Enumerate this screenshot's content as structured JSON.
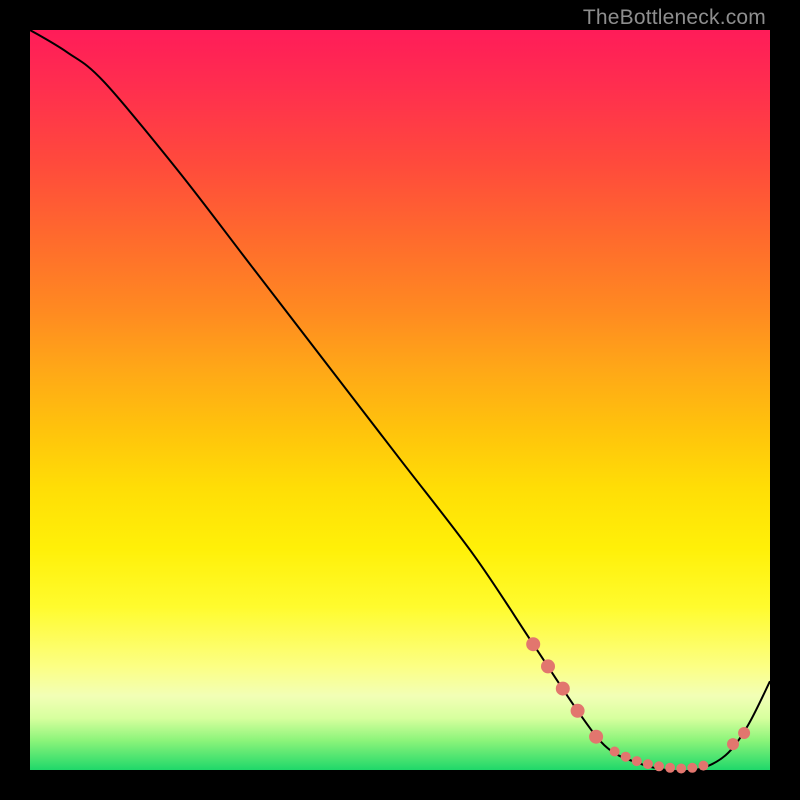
{
  "watermark": "TheBottleneck.com",
  "chart_data": {
    "type": "line",
    "title": "",
    "xlabel": "",
    "ylabel": "",
    "xlim": [
      0,
      100
    ],
    "ylim": [
      0,
      100
    ],
    "series": [
      {
        "name": "curve",
        "x": [
          0,
          5,
          10,
          20,
          30,
          40,
          50,
          60,
          68,
          74,
          78,
          82,
          86,
          90,
          94,
          97,
          100
        ],
        "y": [
          100,
          97,
          93,
          81,
          68,
          55,
          42,
          29,
          17,
          8,
          3,
          1,
          0,
          0,
          2,
          6,
          12
        ],
        "stroke": "#000000",
        "stroke_width": 2
      }
    ],
    "markers": [
      {
        "x": 68.0,
        "y": 17.0,
        "color": "#e2766e",
        "r": 7
      },
      {
        "x": 70.0,
        "y": 14.0,
        "color": "#e2766e",
        "r": 7
      },
      {
        "x": 72.0,
        "y": 11.0,
        "color": "#e2766e",
        "r": 7
      },
      {
        "x": 74.0,
        "y": 8.0,
        "color": "#e2766e",
        "r": 7
      },
      {
        "x": 76.5,
        "y": 4.5,
        "color": "#e2766e",
        "r": 7
      },
      {
        "x": 79.0,
        "y": 2.5,
        "color": "#e2766e",
        "r": 5
      },
      {
        "x": 80.5,
        "y": 1.8,
        "color": "#e2766e",
        "r": 5
      },
      {
        "x": 82.0,
        "y": 1.2,
        "color": "#e2766e",
        "r": 5
      },
      {
        "x": 83.5,
        "y": 0.8,
        "color": "#e2766e",
        "r": 5
      },
      {
        "x": 85.0,
        "y": 0.5,
        "color": "#e2766e",
        "r": 5
      },
      {
        "x": 86.5,
        "y": 0.3,
        "color": "#e2766e",
        "r": 5
      },
      {
        "x": 88.0,
        "y": 0.2,
        "color": "#e2766e",
        "r": 5
      },
      {
        "x": 89.5,
        "y": 0.3,
        "color": "#e2766e",
        "r": 5
      },
      {
        "x": 91.0,
        "y": 0.6,
        "color": "#e2766e",
        "r": 5
      },
      {
        "x": 95.0,
        "y": 3.5,
        "color": "#e2766e",
        "r": 6
      },
      {
        "x": 96.5,
        "y": 5.0,
        "color": "#e2766e",
        "r": 6
      }
    ]
  }
}
